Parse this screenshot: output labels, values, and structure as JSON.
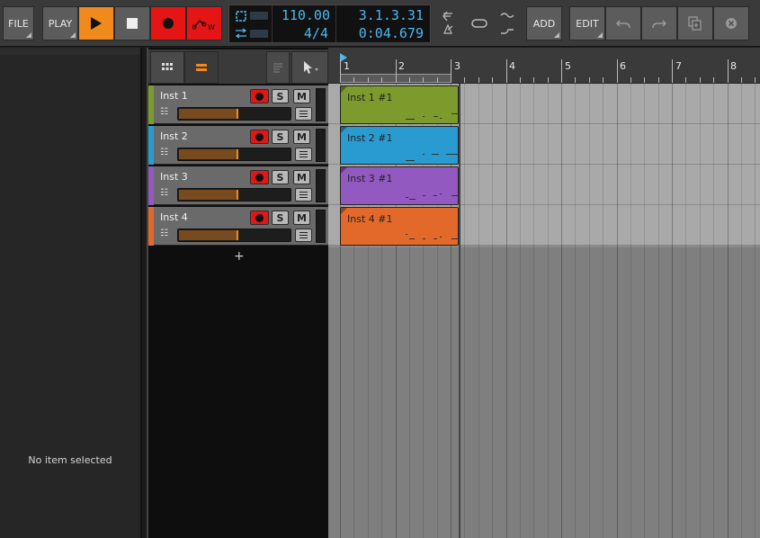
{
  "toolbar": {
    "file_label": "FILE",
    "play_label": "PLAY",
    "add_label": "ADD",
    "edit_label": "EDIT",
    "tempo": "110.00",
    "time_signature": "4/4",
    "position_bars": "3.1.3.31",
    "position_time": "0:04.679"
  },
  "inspector": {
    "empty_text": "No item selected"
  },
  "track_panel": {
    "add_track_label": "+",
    "tracks": [
      {
        "name": "Inst 1",
        "color": "#7d9a2c",
        "solo": "S",
        "mute": "M",
        "volume": 0.52
      },
      {
        "name": "Inst 2",
        "color": "#2a9bd0",
        "solo": "S",
        "mute": "M",
        "volume": 0.52
      },
      {
        "name": "Inst 3",
        "color": "#9259c0",
        "solo": "S",
        "mute": "M",
        "volume": 0.52
      },
      {
        "name": "Inst 4",
        "color": "#e3692a",
        "solo": "S",
        "mute": "M",
        "volume": 0.52
      }
    ]
  },
  "arranger": {
    "ruler_numbers": [
      "1",
      "2",
      "3",
      "4",
      "5",
      "6",
      "7",
      "8"
    ],
    "clips": [
      {
        "name": "Inst 1 #1",
        "color": "#7d9a2c"
      },
      {
        "name": "Inst 2 #1",
        "color": "#2a9bd0"
      },
      {
        "name": "Inst 3 #1",
        "color": "#9259c0"
      },
      {
        "name": "Inst 4 #1",
        "color": "#e3692a"
      }
    ]
  },
  "colors": {
    "accent_orange": "#f08a1c",
    "record_red": "#e51515",
    "lcd_blue": "#4eb7f0"
  }
}
